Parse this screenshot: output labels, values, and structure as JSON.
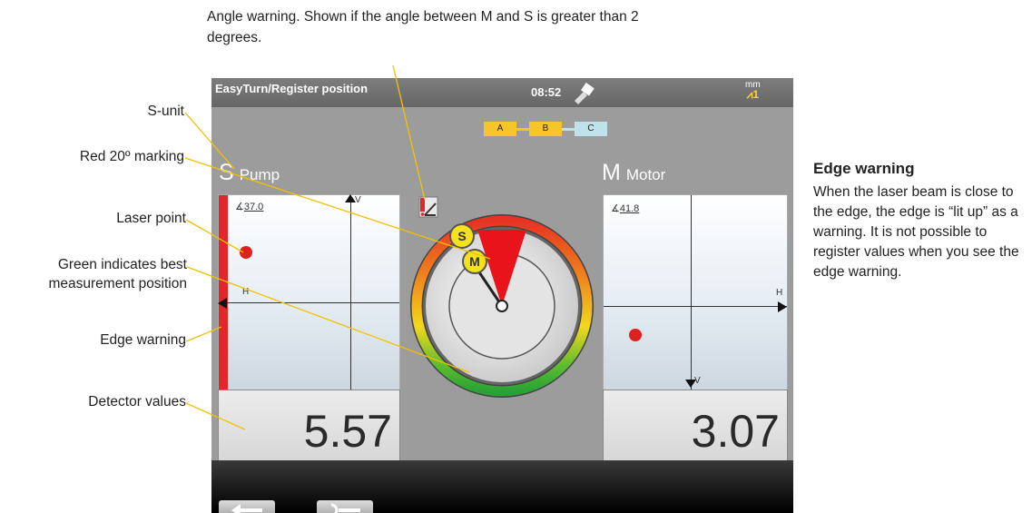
{
  "annotations": {
    "top_note": "Angle warning. Shown if the angle between M and S is greater than 2 degrees.",
    "s_unit": "S-unit",
    "red_marking": "Red 20º marking",
    "laser_point": "Laser point",
    "green_best_line1": "Green indicates best",
    "green_best_line2": "measurement position",
    "edge_warning": "Edge warning",
    "detector_values": "Detector values",
    "edge_title": "Edge warning",
    "edge_body": "When the laser beam is close to the edge, the edge is “lit up” as a warning. It is not possible to register values when you see the edge warning."
  },
  "screen": {
    "title": "EasyTurn/Register position",
    "clock": "08:52",
    "units_label": "mm",
    "units_value": "1",
    "steps": [
      "A",
      "B",
      "C"
    ],
    "s_unit": {
      "letter": "S",
      "name": "Pump",
      "angle": "37.0",
      "axis_v": "V",
      "axis_h": "H",
      "value": "5.57"
    },
    "m_unit": {
      "letter": "M",
      "name": "Motor",
      "angle": "41.8",
      "axis_v": "V",
      "axis_h": "H",
      "value": "3.07"
    },
    "gauge": {
      "s_badge": "S",
      "m_badge": "M"
    }
  },
  "colors": {
    "edge_warning": "#e3262a",
    "laser_point": "#e01f1f",
    "badge": "#f5e21c",
    "step_active": "#f7c52a",
    "step_inactive": "#bfe1ea"
  },
  "icons": [
    "angle-warning-icon",
    "sensor-icon",
    "back-arrow-icon",
    "next-arrow-icon"
  ]
}
